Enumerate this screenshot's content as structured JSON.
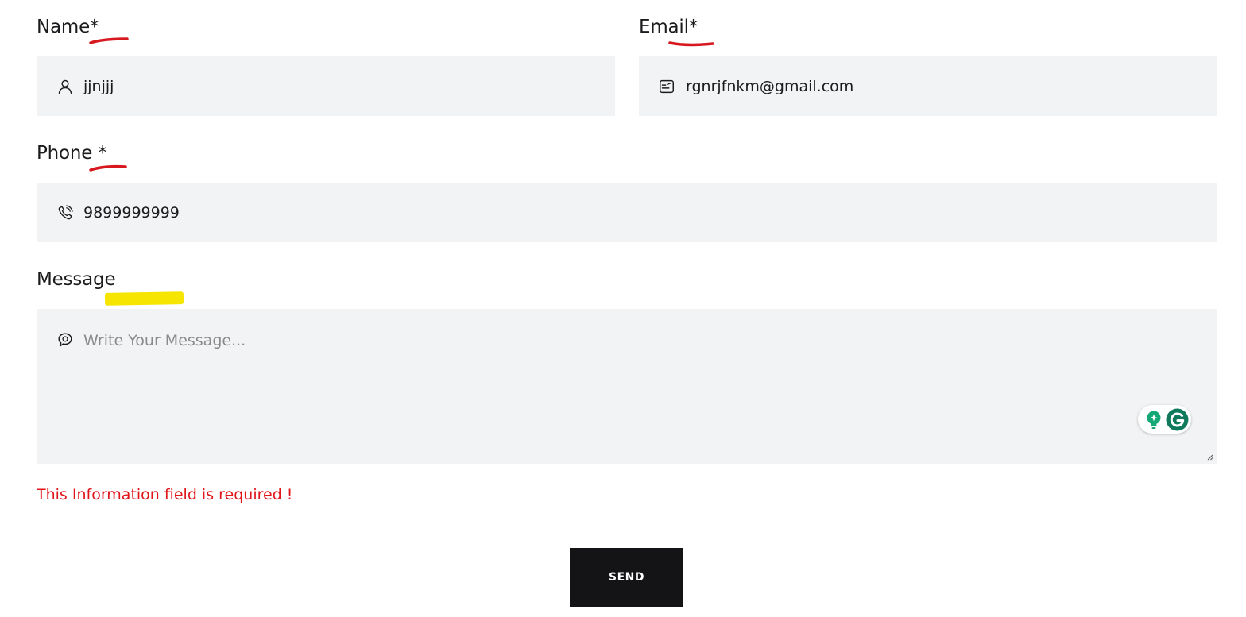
{
  "form": {
    "name": {
      "label": "Name*",
      "value": "jjnjjj",
      "icon": "user-icon"
    },
    "email": {
      "label": "Email*",
      "value": "rgnrjfnkm@gmail.com",
      "icon": "mail-icon"
    },
    "phone": {
      "label": "Phone *",
      "value": "9899999999",
      "icon": "phone-icon"
    },
    "message": {
      "label": "Message",
      "placeholder": "Write Your Message...",
      "icon": "chat-bubble-icon"
    },
    "error_text": "This Information field is required !",
    "submit_label": "SEND"
  },
  "annotations": {
    "required_underline_color": "#d7191f",
    "message_highlight_color": "#f5e500"
  },
  "colors": {
    "field_background": "#f2f3f5",
    "error": "#e0161b",
    "button_background": "#141416",
    "grammarly_green": "#15a877",
    "grammarly_dark": "#0e7a5b"
  }
}
